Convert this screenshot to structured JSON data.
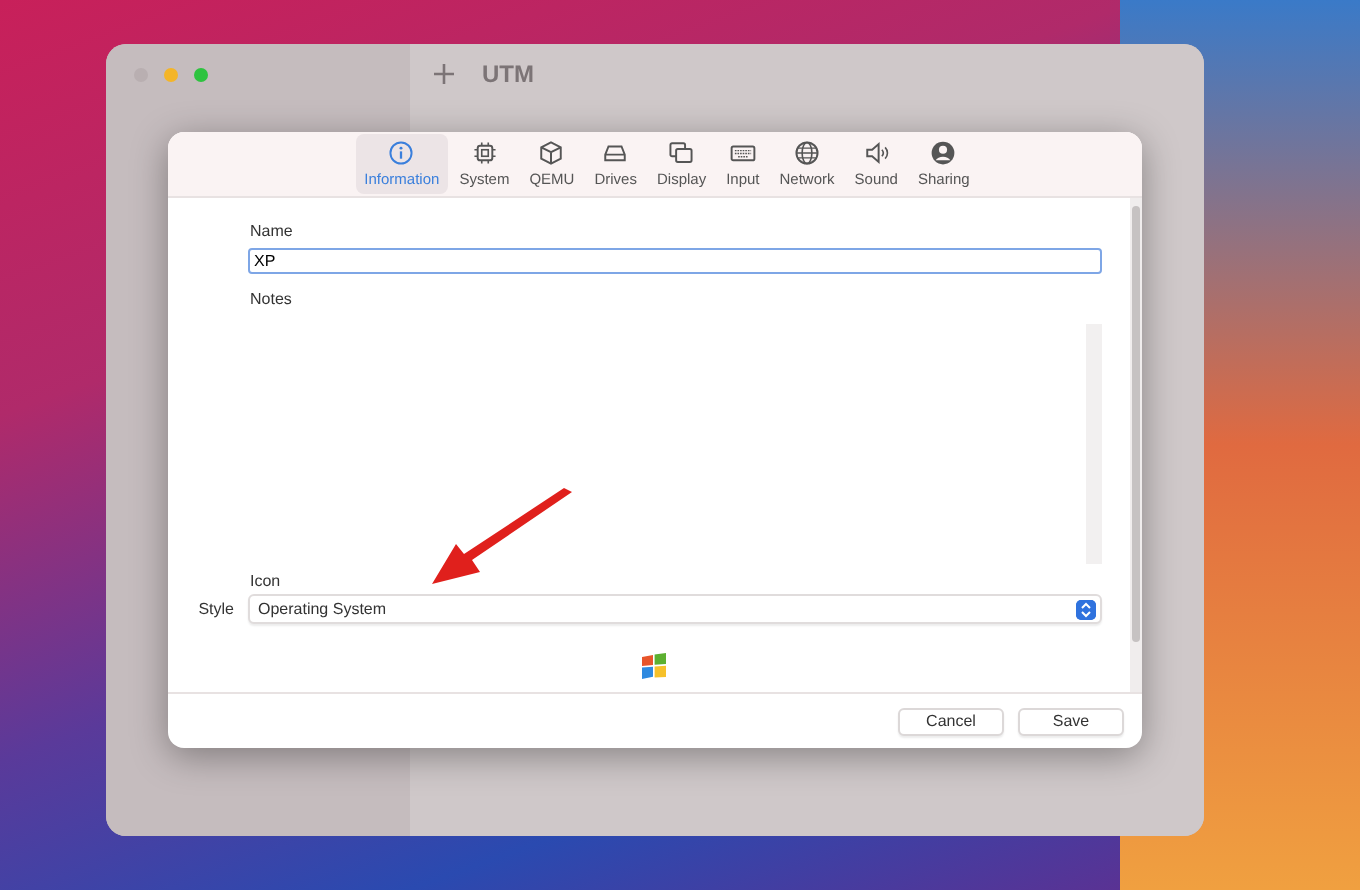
{
  "window": {
    "title": "UTM"
  },
  "tabs": [
    {
      "label": "Information",
      "selected": true
    },
    {
      "label": "System",
      "selected": false
    },
    {
      "label": "QEMU",
      "selected": false
    },
    {
      "label": "Drives",
      "selected": false
    },
    {
      "label": "Display",
      "selected": false
    },
    {
      "label": "Input",
      "selected": false
    },
    {
      "label": "Network",
      "selected": false
    },
    {
      "label": "Sound",
      "selected": false
    },
    {
      "label": "Sharing",
      "selected": false
    }
  ],
  "form": {
    "name_label": "Name",
    "name_value": "XP",
    "notes_label": "Notes",
    "icon_label": "Icon",
    "style_label": "Style",
    "style_value": "Operating System"
  },
  "buttons": [
    "Cancel",
    "Save"
  ]
}
